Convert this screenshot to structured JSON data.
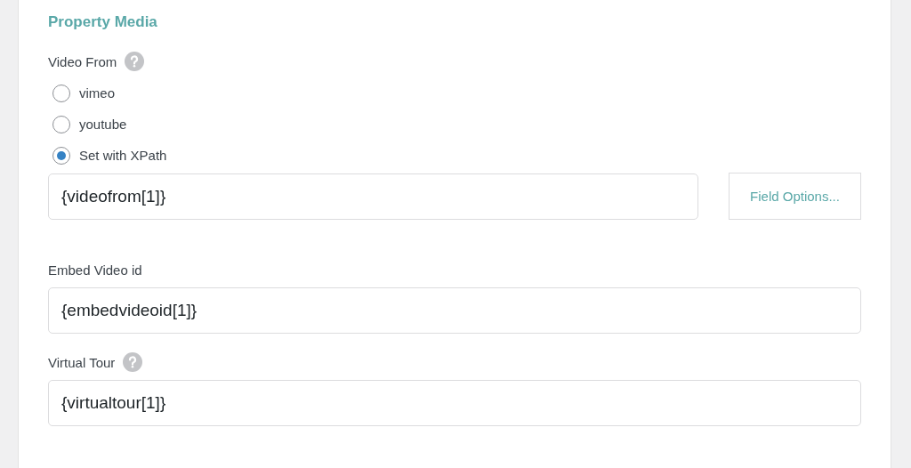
{
  "section": {
    "title": "Property Media"
  },
  "fields": [
    {
      "label": "Video From",
      "help": true,
      "options": [
        {
          "label": "vimeo",
          "selected": false
        },
        {
          "label": "youtube",
          "selected": false
        },
        {
          "label": "Set with XPath",
          "selected": true
        }
      ],
      "value": "{videofrom[1]}",
      "button": "Field Options..."
    },
    {
      "label": "Embed Video id",
      "help": false,
      "value": "{embedvideoid[1]}"
    },
    {
      "label": "Virtual Tour",
      "help": true,
      "value": "{virtualtour[1]}"
    }
  ]
}
